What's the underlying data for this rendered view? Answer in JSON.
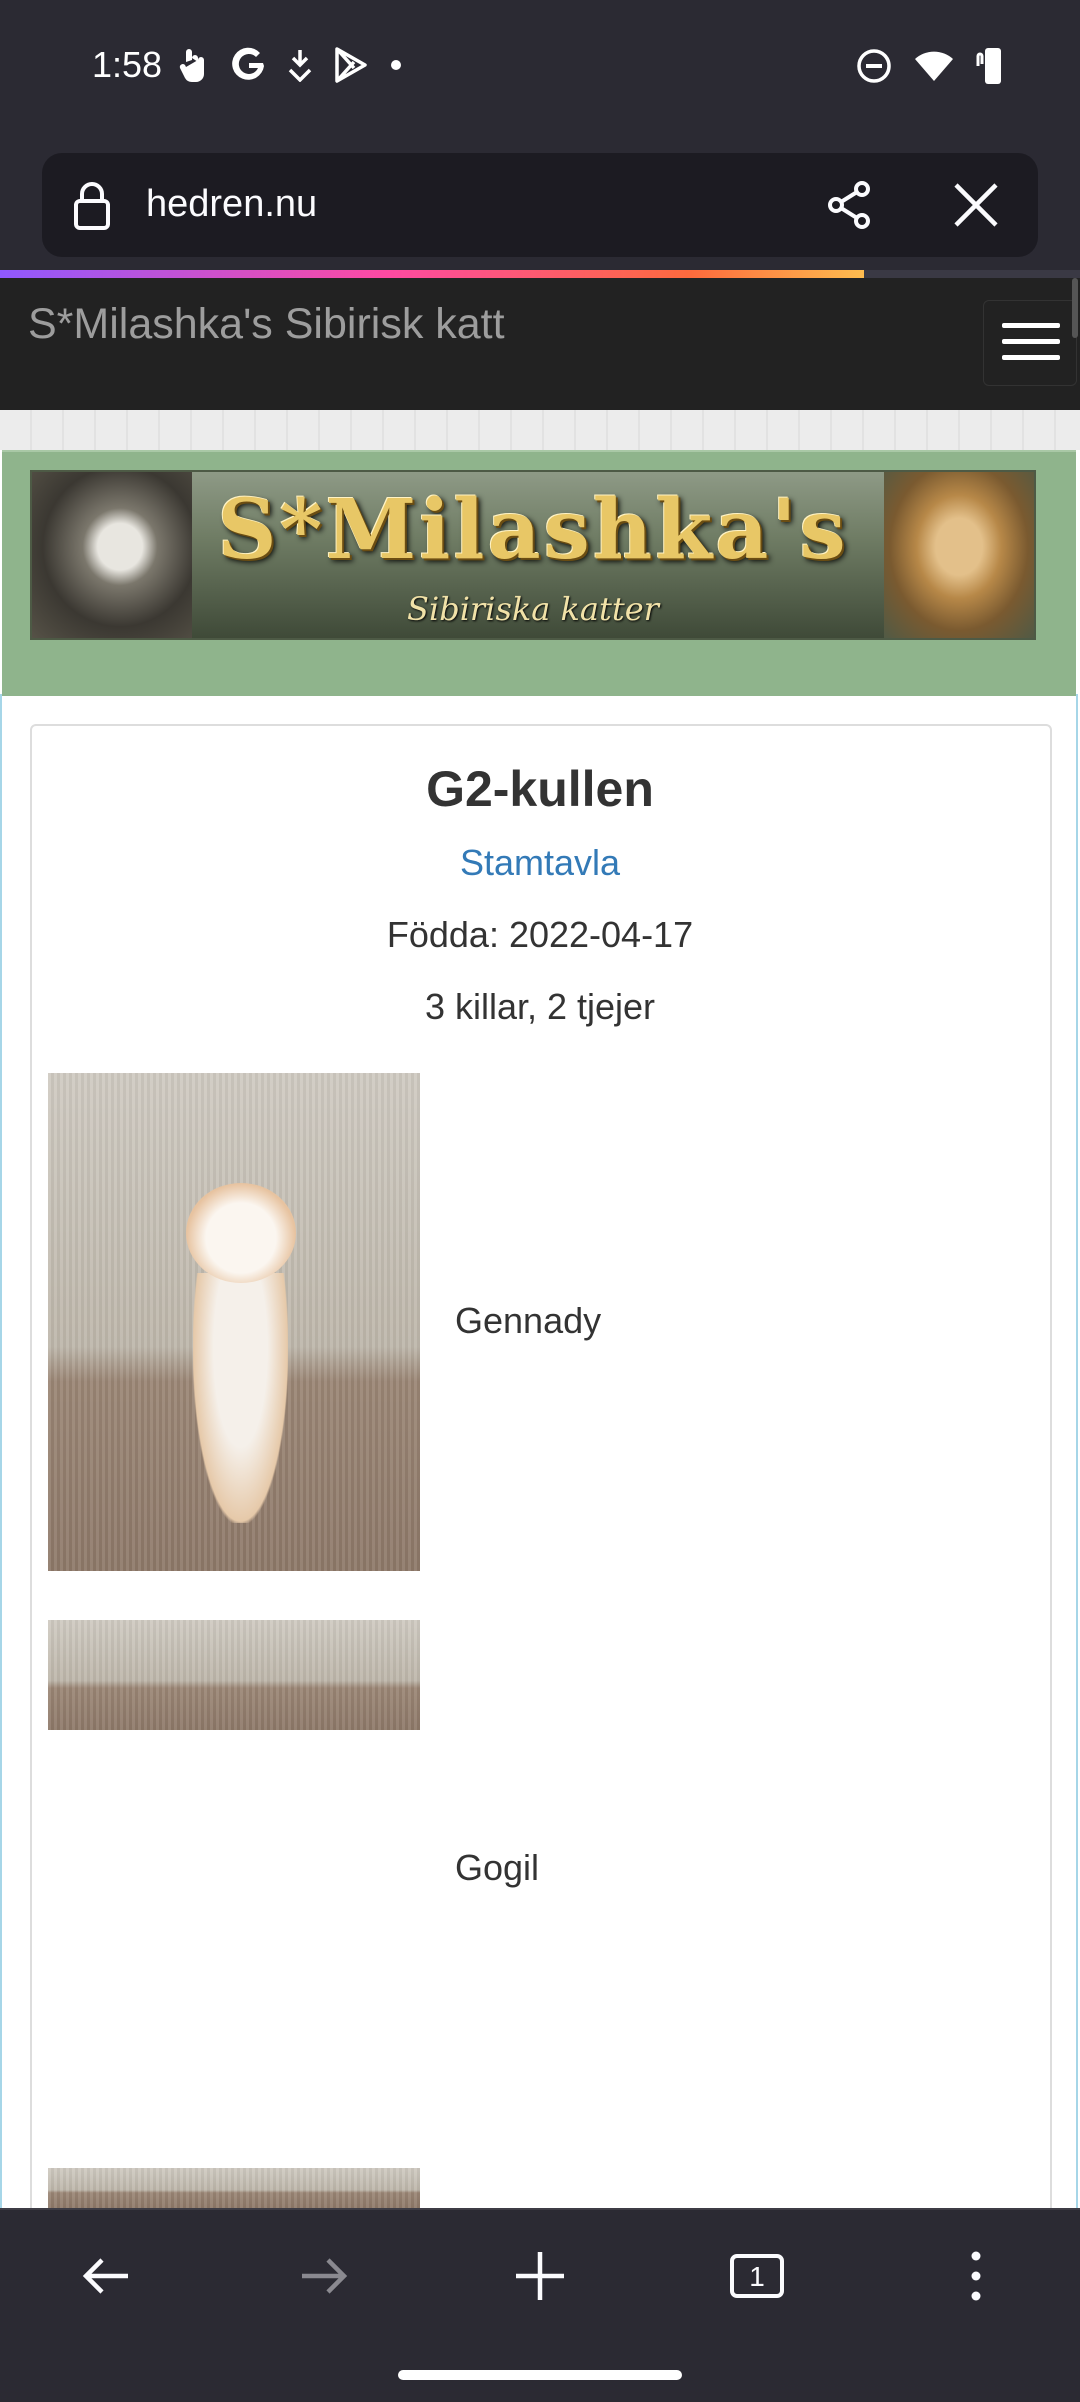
{
  "status_bar": {
    "time": "1:58",
    "left_icons": [
      "hand-cursor-icon",
      "google-icon",
      "download-icon",
      "play-store-icon",
      "dot-icon"
    ],
    "right_icons": [
      "do-not-disturb-icon",
      "wifi-icon",
      "battery-icon"
    ]
  },
  "browser": {
    "url": "hedren.nu",
    "load_progress": 0.8
  },
  "site": {
    "title": "S*Milashka's Sibirisk katt",
    "banner_title": "S*Milashka's",
    "banner_subtitle": "Sibiriska katter"
  },
  "litter": {
    "title": "G2-kullen",
    "pedigree_link": "Stamtavla",
    "born": "Födda: 2022-04-17",
    "count": "3 killar, 2 tjejer",
    "kittens": [
      {
        "name": "Gennady"
      },
      {
        "name": "Gogil"
      }
    ]
  },
  "bottom_nav": {
    "tab_count": "1"
  }
}
